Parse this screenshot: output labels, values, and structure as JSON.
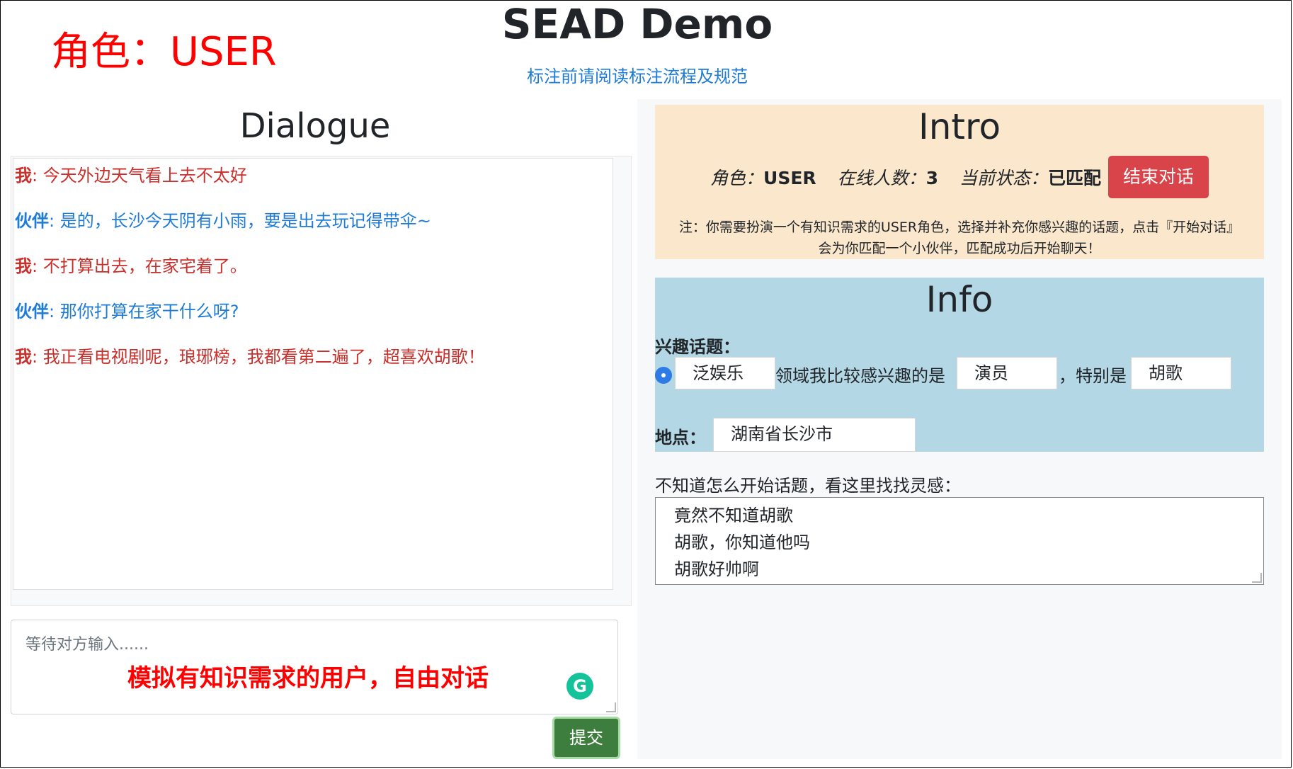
{
  "role_banner": "角色：USER",
  "app": {
    "title": "SEAD Demo",
    "guide_link": "标注前请阅读标注流程及规范"
  },
  "dialogue": {
    "title": "Dialogue",
    "messages": [
      {
        "speaker": "我",
        "text": ": 今天外边天气看上去不太好",
        "role": "me"
      },
      {
        "speaker": "伙伴",
        "text": ": 是的，长沙今天阴有小雨，要是出去玩记得带伞~",
        "role": "partner"
      },
      {
        "speaker": "我",
        "text": ": 不打算出去，在家宅着了。",
        "role": "me"
      },
      {
        "speaker": "伙伴",
        "text": ": 那你打算在家干什么呀?",
        "role": "partner"
      },
      {
        "speaker": "我",
        "text": ": 我正看电视剧呢，琅琊榜，我都看第二遍了，超喜欢胡歌！",
        "role": "me"
      }
    ],
    "input_placeholder": "等待对方输入......",
    "overlay_note": "模拟有知识需求的用户，自由对话",
    "submit_label": "提交"
  },
  "intro": {
    "title": "Intro",
    "role_label": "角色：",
    "role_value": "USER",
    "online_label": "在线人数：",
    "online_value": "3",
    "state_label": "当前状态：",
    "state_value": "已匹配",
    "end_button": "结束对话",
    "note_line1": "注：你需要扮演一个有知识需求的USER角色，选择并补充你感兴趣的话题，点击『开始对话』",
    "note_line2": "会为你匹配一个小伙伴，匹配成功后开始聊天！"
  },
  "info": {
    "title": "Info",
    "interest_label": "兴趣话题：",
    "domain_value": "泛娱乐",
    "text_mid": "领域我比较感兴趣的是",
    "category_value": "演员",
    "text_special": "，特别是",
    "entity_value": "胡歌",
    "location_label": "地点：",
    "location_value": "湖南省长沙市"
  },
  "hints": {
    "label": "不知道怎么开始话题，看这里找找灵感：",
    "lines": [
      "竟然不知道胡歌",
      "胡歌，你知道他吗",
      "胡歌好帅啊"
    ]
  },
  "colors": {
    "me": "#c9302c",
    "partner": "#1e7bd6",
    "intro_bg": "#fbe8cc",
    "info_bg": "#b3d7e5",
    "end_button": "#d9434a",
    "submit_button": "#3d7d3d"
  }
}
